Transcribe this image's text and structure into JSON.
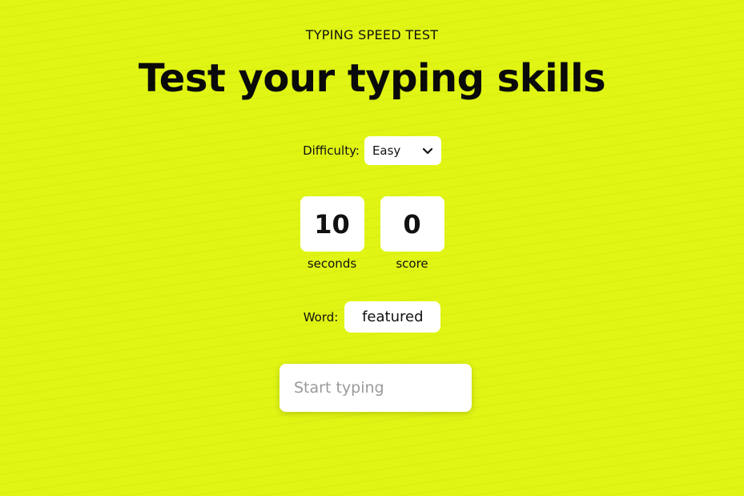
{
  "header": {
    "eyebrow": "TYPING SPEED TEST",
    "title": "Test your typing skills"
  },
  "difficulty": {
    "label": "Difficulty:",
    "selected": "Easy"
  },
  "stats": {
    "time_value": "10",
    "time_label": "seconds",
    "score_value": "0",
    "score_label": "score"
  },
  "word": {
    "label": "Word:",
    "value": "featured"
  },
  "input": {
    "placeholder": "Start typing",
    "value": ""
  },
  "colors": {
    "background": "#e0f514",
    "card": "#ffffff",
    "text": "#111111"
  },
  "icons": {
    "select_arrow": "chevron-down-icon"
  }
}
